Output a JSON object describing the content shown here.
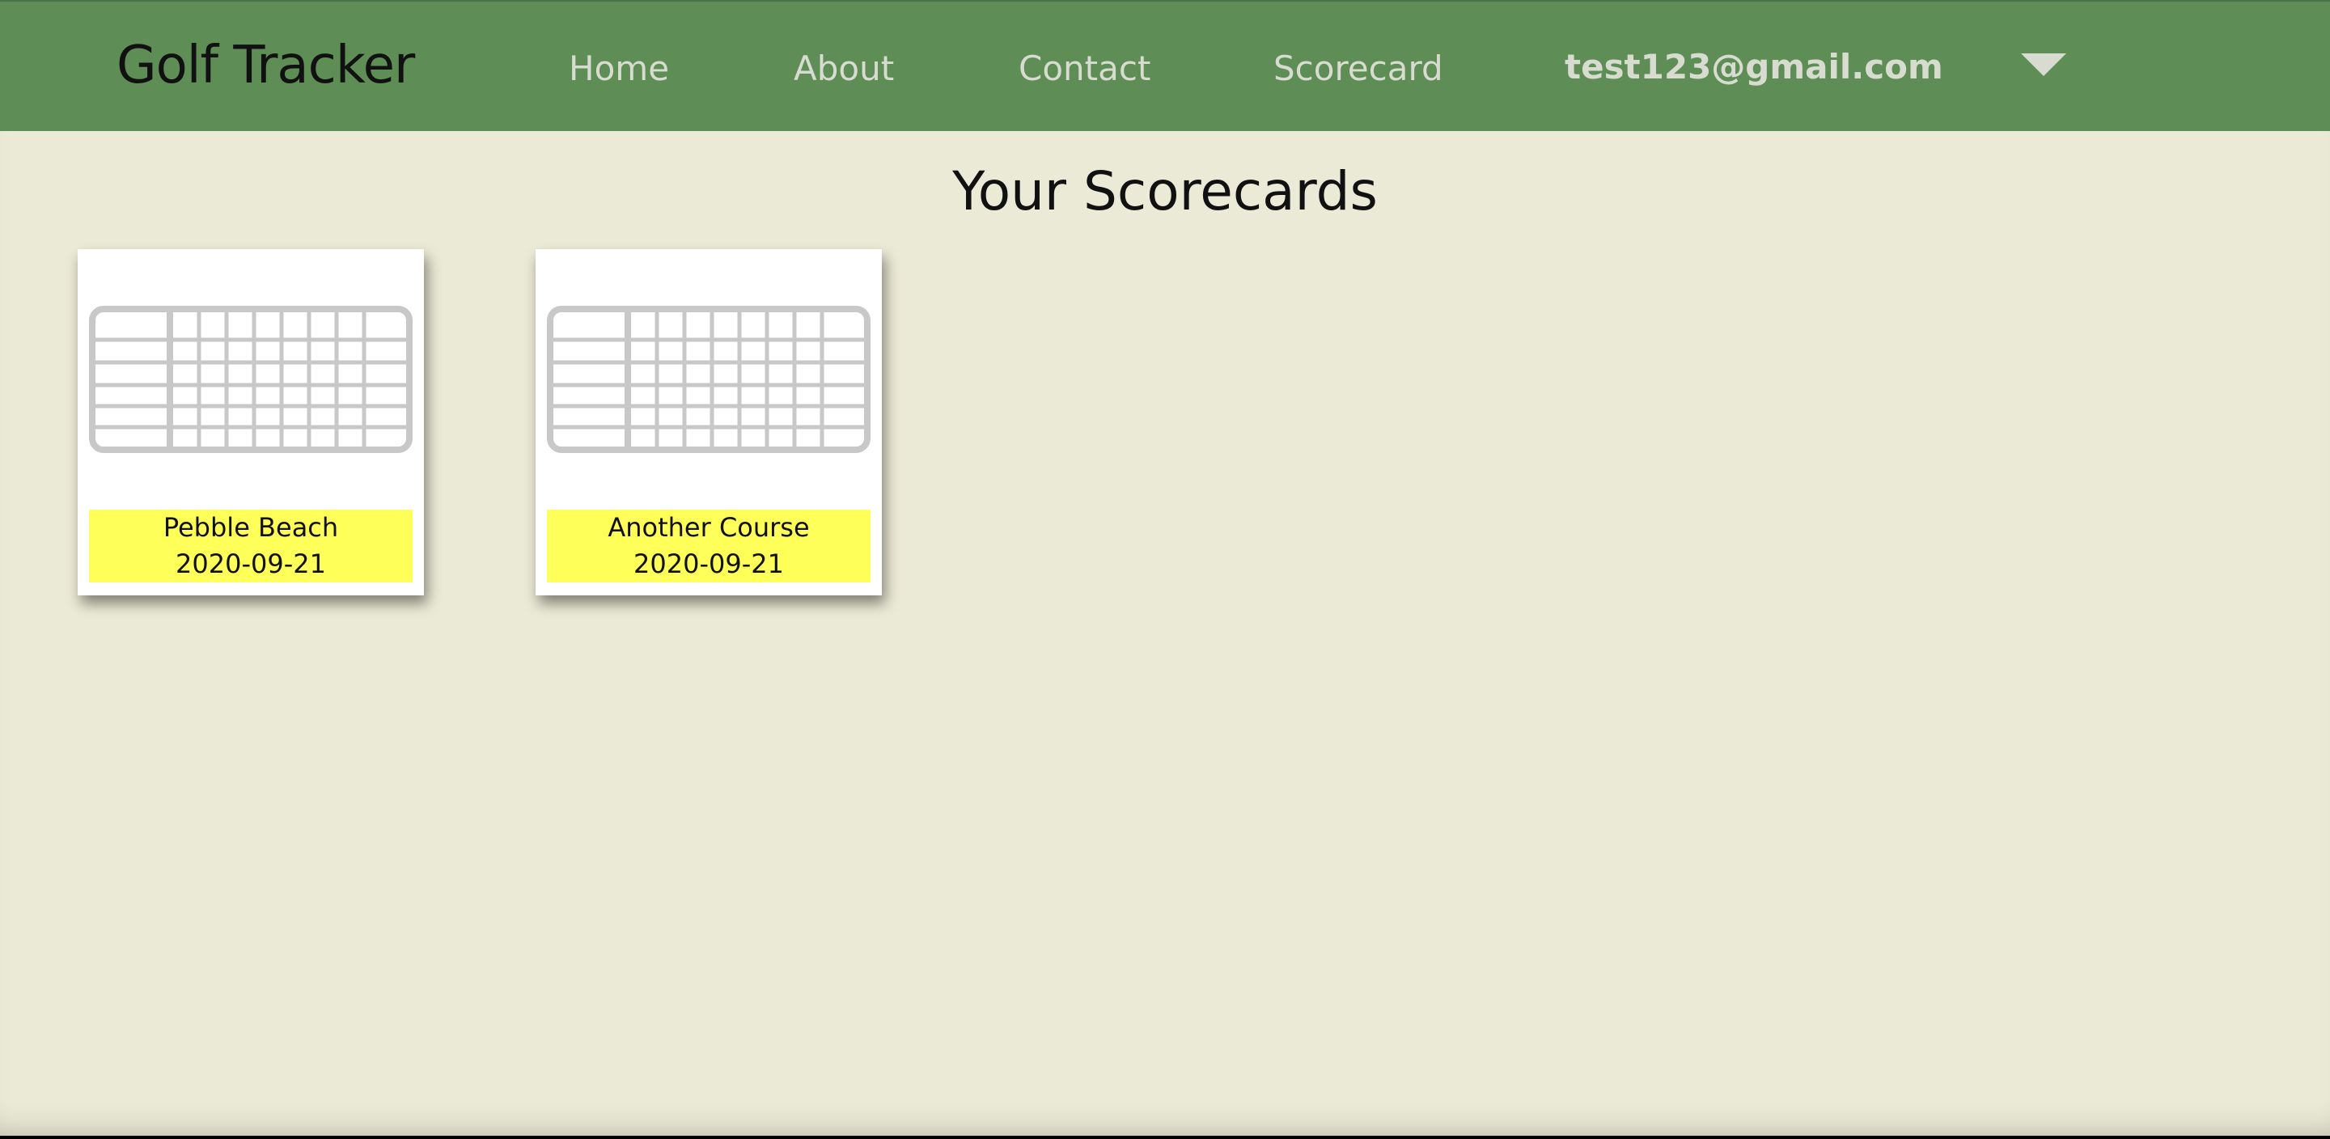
{
  "header": {
    "brand": "Golf Tracker",
    "nav": [
      {
        "label": "Home"
      },
      {
        "label": "About"
      },
      {
        "label": "Contact"
      },
      {
        "label": "Scorecard"
      }
    ],
    "user_email": "test123@gmail.com",
    "dropdown_icon": "caret-down-icon"
  },
  "main": {
    "title": "Your Scorecards",
    "scorecards": [
      {
        "course": "Pebble Beach",
        "date": "2020-09-21",
        "icon": "scorecard-grid-icon"
      },
      {
        "course": "Another Course",
        "date": "2020-09-21",
        "icon": "scorecard-grid-icon"
      }
    ]
  },
  "colors": {
    "navbar": "#5e8e56",
    "background": "#ebead6",
    "card_label": "#ffff5a",
    "nav_text": "#d8dcd0"
  }
}
